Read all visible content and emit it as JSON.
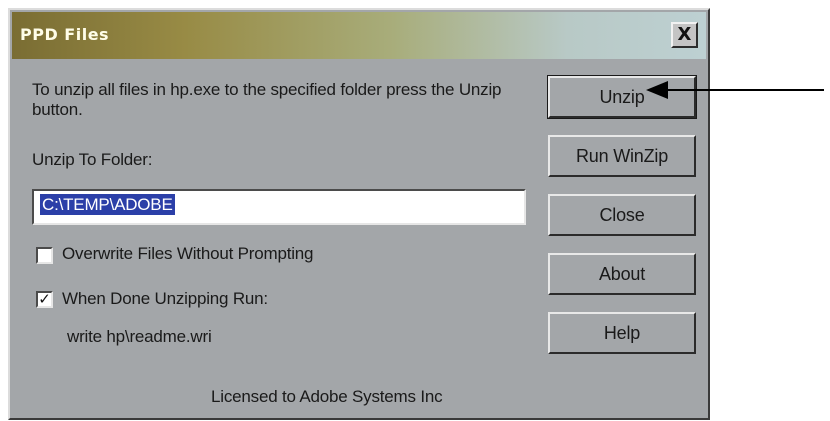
{
  "window": {
    "title": "PPD Files",
    "close_label": "X"
  },
  "dialog": {
    "instructions": "To unzip all files in hp.exe to the specified folder press the Unzip button.",
    "unzip_to_label": "Unzip To Folder:",
    "folder_value": "C:\\TEMP\\ADOBE",
    "overwrite_label": "Overwrite Files Without Prompting",
    "overwrite_checked": false,
    "when_done_label": "When Done Unzipping Run:",
    "when_done_checked": true,
    "run_file": "write hp\\readme.wri",
    "license": "Licensed to Adobe Systems Inc"
  },
  "buttons": {
    "unzip": "Unzip",
    "run_winzip": "Run WinZip",
    "close": "Close",
    "about": "About",
    "help": "Help"
  },
  "colors": {
    "dialog_bg": "#a3a6a9",
    "selection": "#2b3fa8"
  }
}
